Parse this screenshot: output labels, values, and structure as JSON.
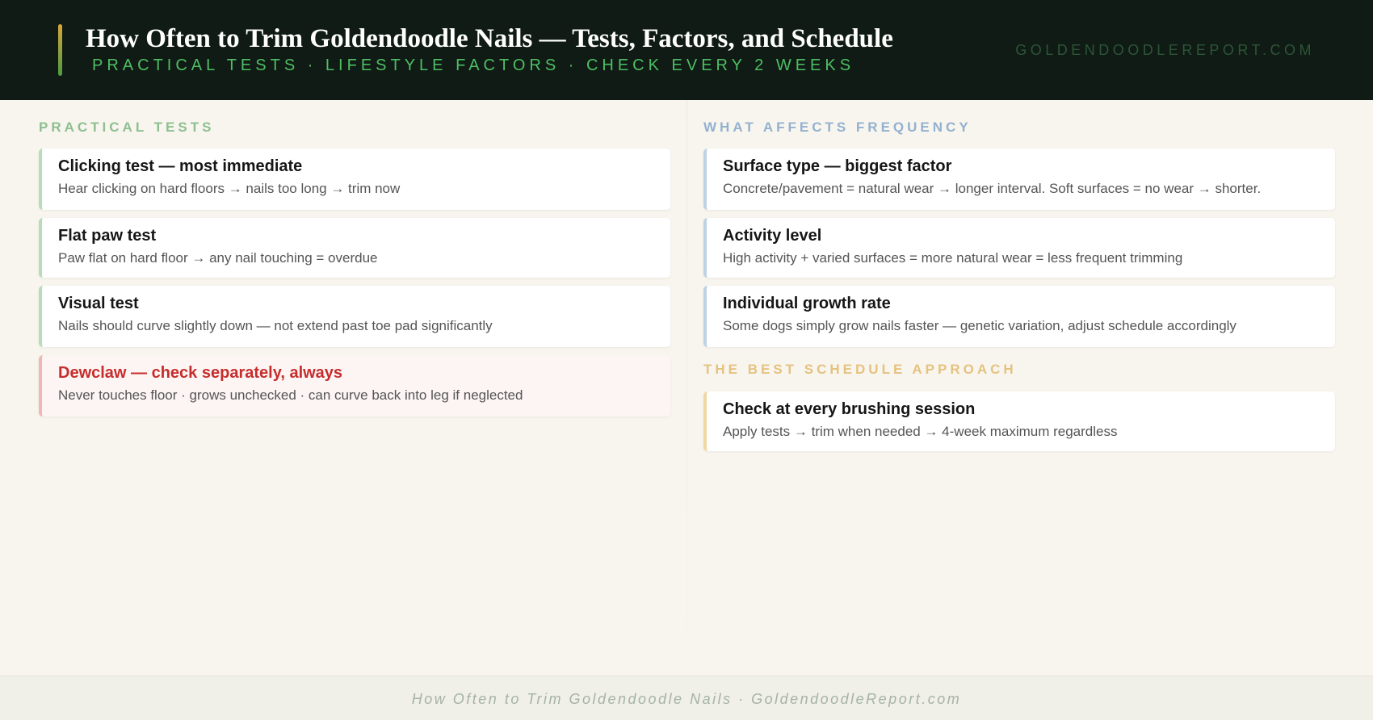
{
  "header": {
    "title": "How Often to Trim Goldendoodle Nails — Tests, Factors, and Schedule",
    "subtitle": "PRACTICAL TESTS · LIFESTYLE FACTORS · CHECK EVERY 2 WEEKS",
    "site": "GOLDENDOODLEREPORT.COM"
  },
  "left": {
    "heading": "PRACTICAL TESTS",
    "heading_color": "#8dbf8f",
    "cards": [
      {
        "title": "Clicking test — most immediate",
        "desc": "Hear clicking on hard floors → nails too long → trim now"
      },
      {
        "title": "Flat paw test",
        "desc": "Paw flat on hard floor → any nail touching = overdue"
      },
      {
        "title": "Visual test",
        "desc": "Nails should curve slightly down — not extend past toe pad significantly"
      },
      {
        "title": "Dewclaw — check separately, always",
        "desc": "Never touches floor · grows unchecked · can curve back into leg if neglected",
        "accent": "#c62d2d"
      }
    ]
  },
  "right": {
    "heading": "WHAT AFFECTS FREQUENCY",
    "heading_color": "#93b1cf",
    "cards": [
      {
        "title": "Surface type — biggest factor",
        "desc": "Concrete/pavement = natural wear → longer interval. Soft surfaces = no wear → shorter."
      },
      {
        "title": "Activity level",
        "desc": "High activity + varied surfaces = more natural wear = less frequent trimming"
      },
      {
        "title": "Individual growth rate",
        "desc": "Some dogs simply grow nails faster — genetic variation, adjust schedule accordingly"
      }
    ],
    "schedule_heading": "THE BEST SCHEDULE APPROACH",
    "schedule_heading_color": "#e6c27f",
    "schedule_card": {
      "title": "Check at every brushing session",
      "desc": "Apply tests → trim when needed → 4-week maximum regardless"
    }
  },
  "footer": {
    "text": "How Often to Trim Goldendoodle Nails · GoldendoodleReport.com"
  }
}
